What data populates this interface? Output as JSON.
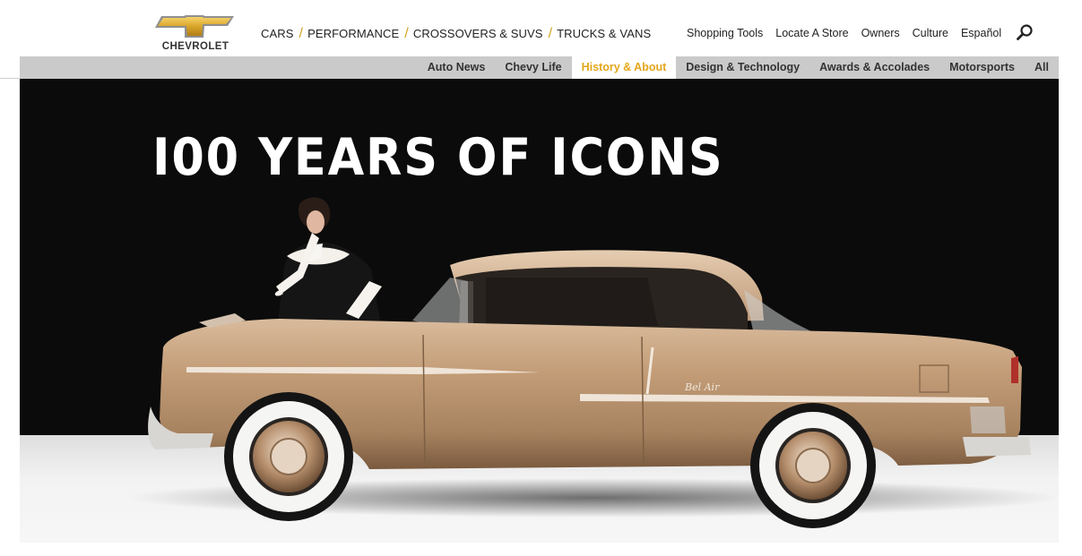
{
  "brand": {
    "name": "CHEVROLET",
    "accent": "#d5a422"
  },
  "primary_nav": [
    {
      "label": "CARS"
    },
    {
      "label": "PERFORMANCE"
    },
    {
      "label": "CROSSOVERS & SUVS"
    },
    {
      "label": "TRUCKS & VANS"
    }
  ],
  "utility_nav": [
    {
      "label": "Shopping Tools"
    },
    {
      "label": "Locate A Store"
    },
    {
      "label": "Owners"
    },
    {
      "label": "Culture"
    },
    {
      "label": "Español"
    }
  ],
  "search": {
    "icon": "search-icon"
  },
  "sub_nav": {
    "active": "History & About",
    "active_color": "#e4a61a",
    "tabs": [
      {
        "label": "Auto News"
      },
      {
        "label": "Chevy Life"
      },
      {
        "label": "History & About"
      },
      {
        "label": "Design & Technology"
      },
      {
        "label": "Awards & Accolades"
      },
      {
        "label": "Motorsports"
      },
      {
        "label": "All"
      }
    ]
  },
  "hero": {
    "title": "I00 YEARS OF ICONS",
    "script_badge": "Bel Air"
  }
}
